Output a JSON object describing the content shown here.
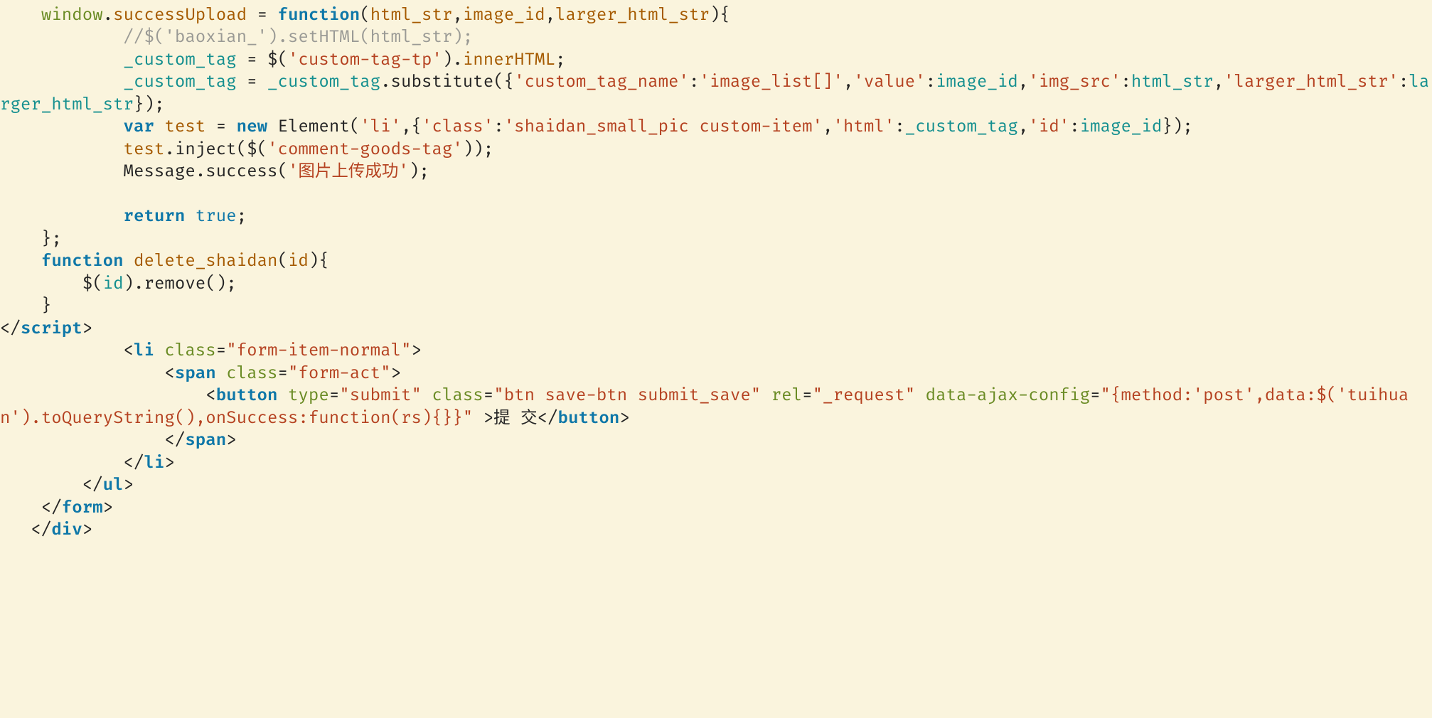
{
  "code": {
    "l1": {
      "t1": "    window",
      "t2": ".",
      "t3": "successUpload",
      "t4": " = ",
      "t5": "function",
      "t6": "(",
      "t7": "html_str",
      "t8": ",",
      "t9": "image_id",
      "t10": ",",
      "t11": "larger_html_str",
      "t12": "){"
    },
    "l2": {
      "t1": "            //$('baoxian_').setHTML(html_str);"
    },
    "l3": {
      "t1": "            ",
      "t2": "_custom_tag",
      "t3": " = $(",
      "t4": "'custom-tag-tp'",
      "t5": ").",
      "t6": "innerHTML",
      "t7": ";"
    },
    "l4": {
      "t1": "            ",
      "t2": "_custom_tag",
      "t3": " = ",
      "t4": "_custom_tag",
      "t5": ".substitute({",
      "t6": "'custom_tag_name'",
      "t7": ":",
      "t8": "'image_list[]'",
      "t9": ",",
      "t10": "'value'",
      "t11": ":",
      "t12": "image_id",
      "t13": ",",
      "t14": "'img_src'",
      "t15": ":",
      "t16": "html_str",
      "t17": ",",
      "t18": "'larger_html_str'",
      "t19": ":",
      "t20": "larger_html_str",
      "t21": "});"
    },
    "l5": {
      "t1": "            ",
      "t2": "var",
      "t3": " ",
      "t4": "test",
      "t5": " = ",
      "t6": "new",
      "t7": " Element(",
      "t8": "'li'",
      "t9": ",{",
      "t10": "'class'",
      "t11": ":",
      "t12": "'shaidan_small_pic custom-item'",
      "t13": ",",
      "t14": "'html'",
      "t15": ":",
      "t16": "_custom_tag",
      "t17": ",",
      "t18": "'id'",
      "t19": ":",
      "t20": "image_id",
      "t21": "});"
    },
    "l6": {
      "t1": "            ",
      "t2": "test",
      "t3": ".inject($(",
      "t4": "'comment-goods-tag'",
      "t5": "));"
    },
    "l7": {
      "t1": "            Message.success(",
      "t2": "'图片上传成功'",
      "t3": ");"
    },
    "l8": "",
    "l9": {
      "t1": "            ",
      "t2": "return",
      "t3": " ",
      "t4": "true",
      "t5": ";"
    },
    "l10": "    };",
    "l11": {
      "t1": "    ",
      "t2": "function",
      "t3": " ",
      "t4": "delete_shaidan",
      "t5": "(",
      "t6": "id",
      "t7": "){"
    },
    "l12": {
      "t1": "        $(",
      "t2": "id",
      "t3": ").remove();"
    },
    "l13": "    }",
    "l14": {
      "t1": "</",
      "t2": "script",
      "t3": ">"
    },
    "l15": {
      "t1": "            <",
      "t2": "li",
      "t3": " ",
      "t4": "class",
      "t5": "=",
      "t6": "\"form-item-normal\"",
      "t7": ">"
    },
    "l16": {
      "t1": "                <",
      "t2": "span",
      "t3": " ",
      "t4": "class",
      "t5": "=",
      "t6": "\"form-act\"",
      "t7": ">"
    },
    "l17": {
      "t1": "                    <",
      "t2": "button",
      "t3": " ",
      "t4": "type",
      "t5": "=",
      "t6": "\"submit\"",
      "t7": " ",
      "t8": "class",
      "t9": "=",
      "t10": "\"btn save-btn submit_save\"",
      "t11": " ",
      "t12": "rel",
      "t13": "=",
      "t14": "\"_request\"",
      "t15": " ",
      "t16": "data-ajax-config",
      "t17": "=",
      "t18": "\"{method:'post',data:$('tuihuan').toQueryString(),onSuccess:function(rs){}}\"",
      "t19": " >提 交</",
      "t20": "button",
      "t21": ">"
    },
    "l18": {
      "t1": "                </",
      "t2": "span",
      "t3": ">"
    },
    "l19": {
      "t1": "            </",
      "t2": "li",
      "t3": ">"
    },
    "l20": {
      "t1": "        </",
      "t2": "ul",
      "t3": ">"
    },
    "l21": {
      "t1": "    </",
      "t2": "form",
      "t3": ">"
    },
    "l22": {
      "t1": "   </",
      "t2": "div",
      "t3": ">"
    }
  }
}
